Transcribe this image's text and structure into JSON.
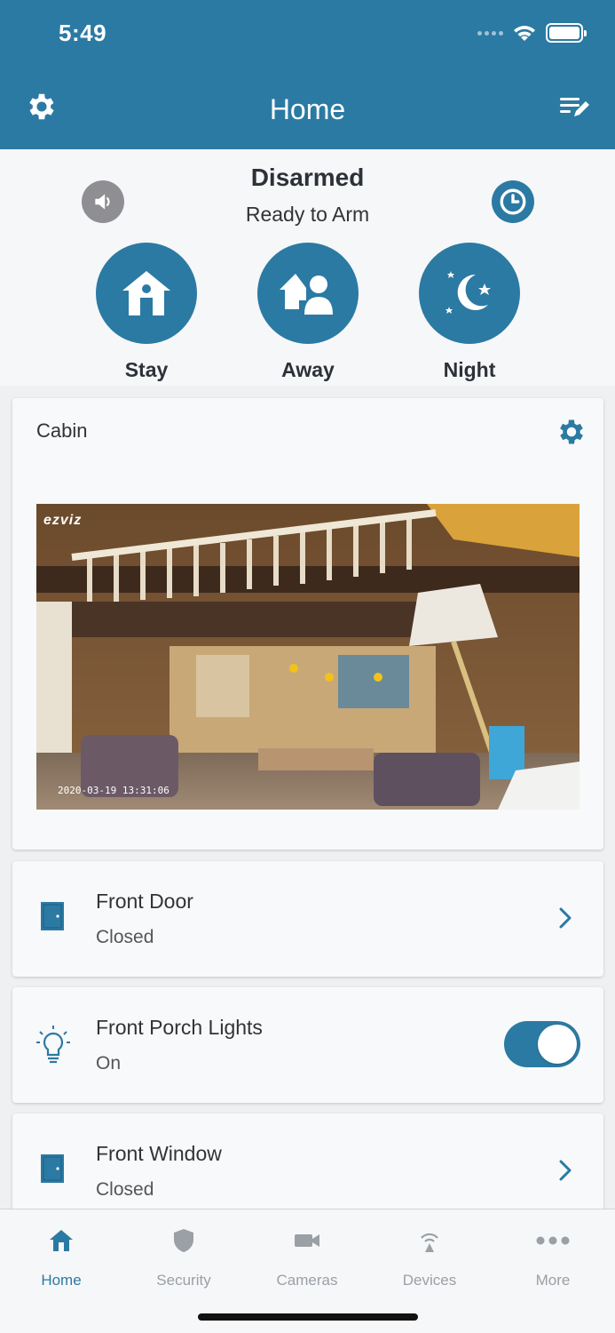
{
  "status_bar": {
    "time": "5:49"
  },
  "header": {
    "title": "Home"
  },
  "arm": {
    "status": "Disarmed",
    "substatus": "Ready to Arm",
    "modes": [
      {
        "label": "Stay",
        "icon": "house-icon"
      },
      {
        "label": "Away",
        "icon": "house-person-icon"
      },
      {
        "label": "Night",
        "icon": "moon-stars-icon"
      }
    ]
  },
  "camera": {
    "title": "Cabin",
    "logo": "ezviz",
    "timestamp": "2020-03-19 13:31:06"
  },
  "devices": [
    {
      "name": "Front Door",
      "status": "Closed",
      "icon": "door-icon"
    },
    {
      "name": "Front Porch Lights",
      "status": "On",
      "icon": "lightbulb-icon",
      "toggle_on": true
    },
    {
      "name": "Front Window",
      "status": "Closed",
      "icon": "window-icon"
    }
  ],
  "tabs": [
    {
      "label": "Home",
      "icon": "home-icon",
      "active": true
    },
    {
      "label": "Security",
      "icon": "shield-icon"
    },
    {
      "label": "Cameras",
      "icon": "video-camera-icon"
    },
    {
      "label": "Devices",
      "icon": "wireless-icon"
    },
    {
      "label": "More",
      "icon": "more-icon"
    }
  ],
  "colors": {
    "primary": "#2b7aa3",
    "background": "#eef0f2",
    "inactive_tab": "#9aa0a6"
  }
}
